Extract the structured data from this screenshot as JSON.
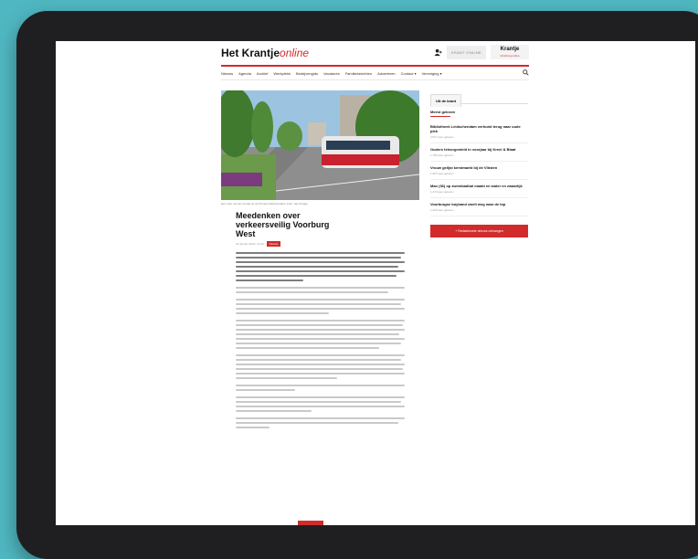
{
  "site": {
    "logo_main": "Het Krantje",
    "logo_accent": "online",
    "online_button": "KRANT ONLINE",
    "mini_logo_title": "Krantje",
    "mini_logo_sub": "Voorburg online"
  },
  "nav": [
    "Nieuws",
    "Agenda",
    "Archief",
    "Werkplekk",
    "Bedrijvengids",
    "Vacatures",
    "Familieberichten",
    "Adverteren",
    "Contact",
    "Vereniging"
  ],
  "article": {
    "caption": "Een tram van lijn 19 rijdt op de Prinses Mariannelaan. Foto: Het Krantje",
    "title": "Meedenken over verkeersveilig Voorburg West",
    "date": "24 januari 2023 | 14:00",
    "tag": "Nieuws"
  },
  "sidebar": {
    "tab": "Uit de krant",
    "heading": "Meest gelezen",
    "items": [
      {
        "title": "Bibliotheek Leidschendam verhuist terug naar oude plek",
        "meta": "2.517 keer gelezen"
      },
      {
        "title": "Ouders teleurgesteld in voorjaar bij Kreel & Blaat",
        "meta": "1.785 keer gelezen"
      },
      {
        "title": "Vrouw gelijst kerstmarkt bij de Vlieden",
        "meta": "1.607 keer gelezen"
      },
      {
        "title": "Man (36) op zwembadbal maakt en water en zwaarlijk",
        "meta": "1.472 keer gelezen"
      },
      {
        "title": "Voorburgse boyband zwelt weg naar de top",
        "meta": "1.426 keer gelezen"
      }
    ],
    "button": "+ Redactionele nieuws ontvangen"
  },
  "colors": {
    "accent": "#d22b2b",
    "backdrop": "#4fb7c1"
  }
}
